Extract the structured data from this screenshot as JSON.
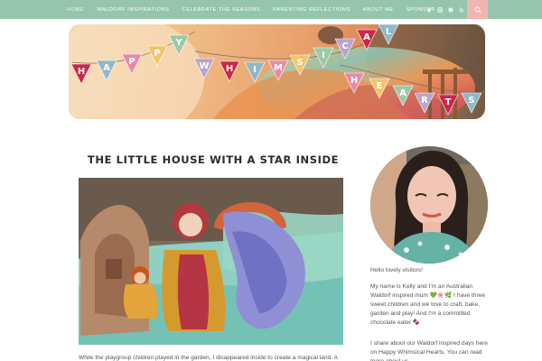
{
  "nav": {
    "items": [
      {
        "label": "HOME"
      },
      {
        "label": "WALDORF INSPIRATIONS"
      },
      {
        "label": "CELEBRATE THE SEASONS"
      },
      {
        "label": "PARENTING REFLECTIONS"
      },
      {
        "label": "ABOUT ME"
      },
      {
        "label": "SPONSOR"
      }
    ],
    "social_icons": [
      "facebook-icon",
      "instagram-icon",
      "pinterest-icon",
      "rss-icon"
    ],
    "search_icon": "search-icon"
  },
  "banner": {
    "flags": [
      "H",
      "A",
      "P",
      "P",
      "Y",
      "W",
      "H",
      "I",
      "M",
      "S",
      "I",
      "C",
      "A",
      "L",
      "H",
      "E",
      "A",
      "R",
      "T",
      "S"
    ]
  },
  "post": {
    "title": "THE LITTLE HOUSE WITH A STAR INSIDE",
    "excerpt": "While the playgroup children played in the garden, I disappeared inside to create a magical land. A"
  },
  "sidebar": {
    "greeting": "Hello lovely visitors!",
    "intro": "My name is Kelly and I'm an Australian Waldorf inspired mum 💚🌸🌿 I have three sweet children and we love to craft, bake, garden and play! And I'm a committed chocolate eater 🍫",
    "share": "I share about our Waldorf inspired days here on Happy Whimsical Hearts. You can read more about us..."
  },
  "colors": {
    "nav_bg": "#95c5ad",
    "search_bg": "#f2b4b0",
    "flag_colors": [
      "#c7294a",
      "#8fb8c9",
      "#e88aa7",
      "#f3c46a",
      "#9cc9a8",
      "#b7a4cf"
    ]
  }
}
